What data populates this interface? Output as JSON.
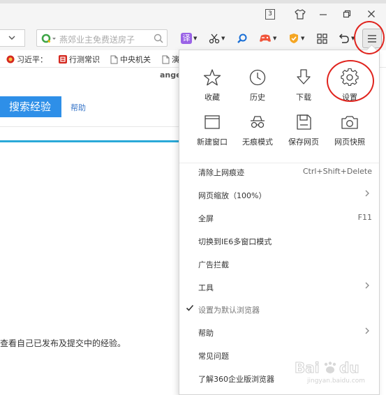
{
  "titlebar": {
    "tab_count": "3"
  },
  "toolbar": {
    "search_placeholder": "燕郊业主免费送房子",
    "translate_glyph": "译"
  },
  "bookmarks": [
    {
      "label": "习近平："
    },
    {
      "label": "行测常识"
    },
    {
      "label": "中央机关"
    },
    {
      "label": "演"
    }
  ],
  "page": {
    "username": "angel",
    "search_button": "搜索经验",
    "help_link": "帮助",
    "description": "查看自己已发布及提交中的经验。"
  },
  "menu": {
    "tiles": [
      {
        "label": "收藏",
        "icon": "star-icon"
      },
      {
        "label": "历史",
        "icon": "clock-icon"
      },
      {
        "label": "下载",
        "icon": "download-icon"
      },
      {
        "label": "设置",
        "icon": "gear-icon"
      },
      {
        "label": "新建窗口",
        "icon": "window-icon"
      },
      {
        "label": "无痕模式",
        "icon": "incognito-icon"
      },
      {
        "label": "保存网页",
        "icon": "save-icon"
      },
      {
        "label": "网页快照",
        "icon": "camera-icon"
      }
    ],
    "items": [
      {
        "label": "清除上网痕迹",
        "shortcut": "Ctrl+Shift+Delete"
      },
      {
        "label": "网页缩放（100%）",
        "submenu": true
      },
      {
        "label": "全屏",
        "shortcut": "F11"
      },
      {
        "label": "切换到IE6多窗口模式"
      },
      {
        "label": "广告拦截"
      },
      {
        "label": "工具",
        "submenu": true
      },
      {
        "label": "设置为默认浏览器",
        "checked": true
      },
      {
        "label": "帮助",
        "submenu": true
      },
      {
        "label": "常见问题"
      },
      {
        "label": "了解360企业版浏览器"
      }
    ]
  },
  "watermark": {
    "brand": "Baidu",
    "sub": "jingyan.baidu.com"
  },
  "colors": {
    "accent": "#2e8fe8",
    "annotation": "#e0241e",
    "divider_blue": "#2aa9d8"
  }
}
